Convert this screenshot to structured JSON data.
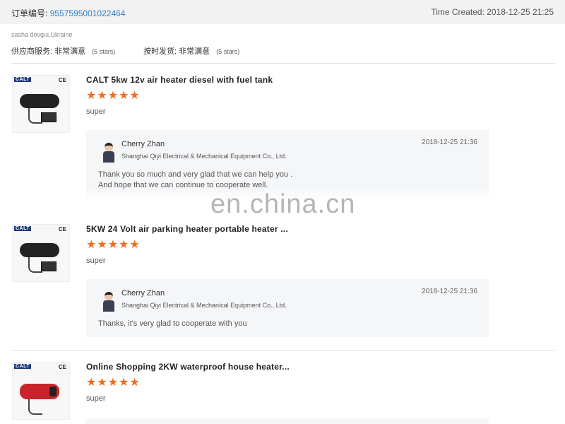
{
  "header": {
    "order_label": "订单编号:",
    "order_number": "9557595001022464",
    "time_created": "Time Created: 2018-12-25 21:25"
  },
  "buyer": {
    "name": "sasha dovgui,Ukraine",
    "ratings": [
      {
        "label": "供应商服务:",
        "value": "非常满意",
        "stars": "(5 stars)"
      },
      {
        "label": "按时发货:",
        "value": "非常满意",
        "stars": "(5 stars)"
      }
    ]
  },
  "items": [
    {
      "brand": "CALT",
      "ce": "CE",
      "title": "CALT 5kw 12v air heater diesel with fuel tank",
      "rating": 5,
      "stars": "★★★★★",
      "comment": "super",
      "reply": {
        "name": "Cherry Zhan",
        "company": "Shanghai Qiyi Electrical & Mechanical Equipment Co., Ltd.",
        "time": "2018-12-25 21:36",
        "lines": [
          "Thank you so much and very glad that we can help you .",
          "And hope that we can continue to cooperate  well."
        ]
      }
    },
    {
      "brand": "CALT",
      "ce": "CE",
      "title": "5KW 24 Volt air parking heater portable heater ...",
      "rating": 5,
      "stars": "★★★★★",
      "comment": "super",
      "reply": {
        "name": "Cherry Zhan",
        "company": "Shanghai Qiyi Electrical & Mechanical Equipment Co., Ltd.",
        "time": "2018-12-25 21:36",
        "lines": [
          "Thanks, it's very glad to cooperate with you"
        ]
      }
    },
    {
      "brand": "CALT",
      "ce": "CE",
      "title": "Online Shopping 2KW waterproof house heater...",
      "rating": 5,
      "stars": "★★★★★",
      "comment": "super"
    }
  ],
  "watermark": "en.china.cn",
  "colors": {
    "stars": "#f26b1d",
    "order_link": "#2a7fc9"
  }
}
